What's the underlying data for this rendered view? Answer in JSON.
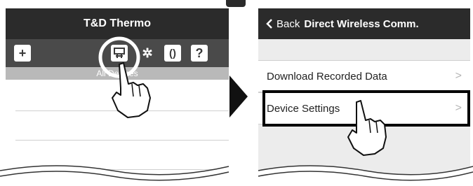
{
  "left_screen": {
    "title": "T&D Thermo",
    "toolbar": {
      "add_label": "+",
      "wireless_label": "wireless",
      "gear_label": "✲",
      "sync_label": "()",
      "help_label": "?"
    },
    "subheader": "All Devices"
  },
  "right_screen": {
    "back_label": "Back",
    "title": "Direct Wireless Comm.",
    "menu_items": [
      {
        "label": "Download Recorded Data",
        "chevron": ">"
      },
      {
        "label": "Device Settings",
        "chevron": ">"
      }
    ]
  },
  "colors": {
    "titlebar": "#2b2b2b",
    "toolbar": "#4a4a4a",
    "subheader": "#b9b9b9",
    "highlight": "#000000"
  }
}
